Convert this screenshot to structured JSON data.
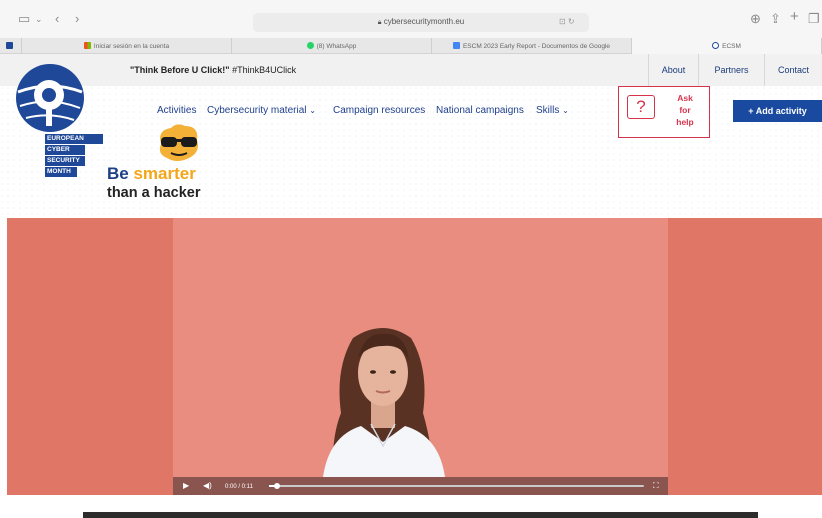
{
  "browser": {
    "url": "cybersecuritymonth.eu",
    "tabs": [
      {
        "label": "Iniciar sesión en la cuenta",
        "icon": "microsoft-icon"
      },
      {
        "label": "(8) WhatsApp",
        "icon": "whatsapp-icon"
      },
      {
        "label": "ESCM 2023 Early Report - Documentos de Google",
        "icon": "google-docs-icon"
      },
      {
        "label": "ECSM",
        "icon": "ecsm-icon"
      }
    ]
  },
  "topbar": {
    "tagline_bold": "\"Think Before U Click!\"",
    "tagline_rest": "#ThinkB4UClick",
    "links": [
      "About",
      "Partners",
      "Contact"
    ]
  },
  "logo": {
    "lines": [
      "EUROPEAN",
      "CYBER",
      "SECURITY",
      "MONTH"
    ]
  },
  "nav": {
    "items": [
      "Activities",
      "Cybersecurity material",
      "Campaign resources",
      "National campaigns",
      "Skills"
    ]
  },
  "help": {
    "line1": "Ask",
    "line2": "for",
    "line3": "help"
  },
  "add_button": "+ Add activity",
  "campaign": {
    "word1": "Be ",
    "word2": "smarter",
    "line2": "than a hacker"
  },
  "video": {
    "time": "0:00  /  0:11",
    "progress": 0.02
  },
  "colors": {
    "brand_blue": "#1a4aa0",
    "hero_bg": "#e07766",
    "accent_red": "#d6334b",
    "accent_yellow": "#f3a619"
  }
}
